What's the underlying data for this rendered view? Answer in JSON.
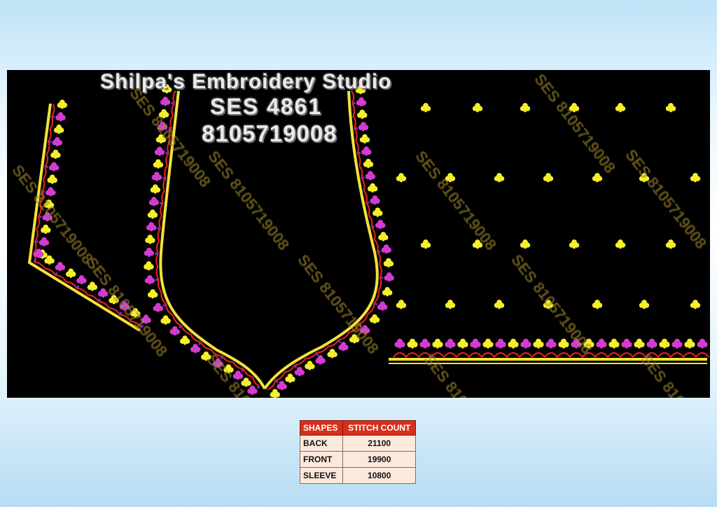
{
  "brand": {
    "name": "Shilpa's  Embroidery  Studio",
    "code": "SES  4861",
    "phone": "8105719008"
  },
  "watermark": "SES 8105719008",
  "colors": {
    "background": "#000000",
    "outline": "#f2e23a",
    "scallop": "#e02020",
    "flower_magenta": "#d23ccf",
    "flower_yellow": "#f4ef2a",
    "header": "#d6301c"
  },
  "table": {
    "headers": [
      "SHAPES",
      "STITCH COUNT"
    ],
    "rows": [
      {
        "shape": "BACK",
        "count": "21100"
      },
      {
        "shape": "FRONT",
        "count": "19900"
      },
      {
        "shape": "SLEEVE",
        "count": "10800"
      }
    ]
  }
}
